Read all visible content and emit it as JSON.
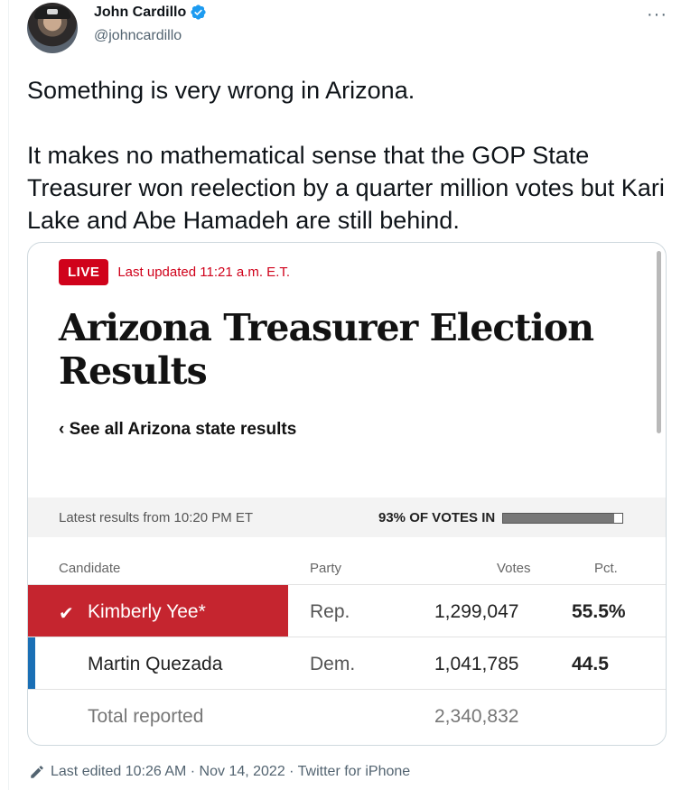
{
  "author": {
    "name": "John Cardillo",
    "handle": "@johncardillo",
    "avatar_icon": "avatar-photo",
    "verified_color": "#1d9bf0"
  },
  "more_label": "···",
  "tweet_text": "Something is very wrong in Arizona.\n\nIt makes no mathematical sense that the GOP State Treasurer won reelection by a quarter million votes but Kari Lake and Abe Hamadeh are still behind.",
  "card": {
    "live_label": "LIVE",
    "updated": "Last updated 11:21 a.m. E.T.",
    "headline": "Arizona Treasurer Election Results",
    "see_all": "‹ See all Arizona state results",
    "latest_results": "Latest results from 10:20 PM ET",
    "votes_in": "93% OF VOTES IN",
    "votes_in_fraction": 0.93,
    "columns": {
      "candidate": "Candidate",
      "party": "Party",
      "votes": "Votes",
      "pct": "Pct."
    },
    "rows": [
      {
        "check": "✔",
        "candidate": "Kimberly Yee*",
        "party": "Rep.",
        "votes": "1,299,047",
        "pct": "55.5%"
      },
      {
        "candidate": "Martin Quezada",
        "party": "Dem.",
        "votes": "1,041,785",
        "pct": "44.5"
      }
    ],
    "total_label": "Total reported",
    "total_votes": "2,340,832",
    "colors": {
      "live_red": "#d0021b",
      "rep_red": "#c5252f",
      "dem_blue": "#1a6fb5"
    }
  },
  "footer": {
    "edited": "Last edited 10:26 AM · Nov 14, 2022 · Twitter for iPhone"
  }
}
